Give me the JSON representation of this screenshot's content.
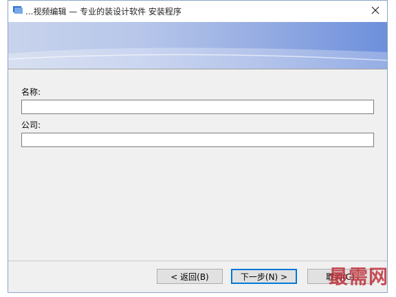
{
  "window": {
    "title": "...视频编辑 — 专业的装设计软件 安装程序",
    "close_symbol": "×"
  },
  "form": {
    "name_label": "名称:",
    "name_value": "",
    "company_label": "公司:",
    "company_value": ""
  },
  "buttons": {
    "back": "< 返回(B)",
    "next": "下一步(N) >",
    "cancel": "取消(C)"
  },
  "watermark": "最需网",
  "colors": {
    "accent": "#0078d7",
    "banner_light": "#c8d3ec",
    "banner_dark": "#6d8fdc"
  },
  "icons": [
    "app-icon",
    "close-icon"
  ]
}
